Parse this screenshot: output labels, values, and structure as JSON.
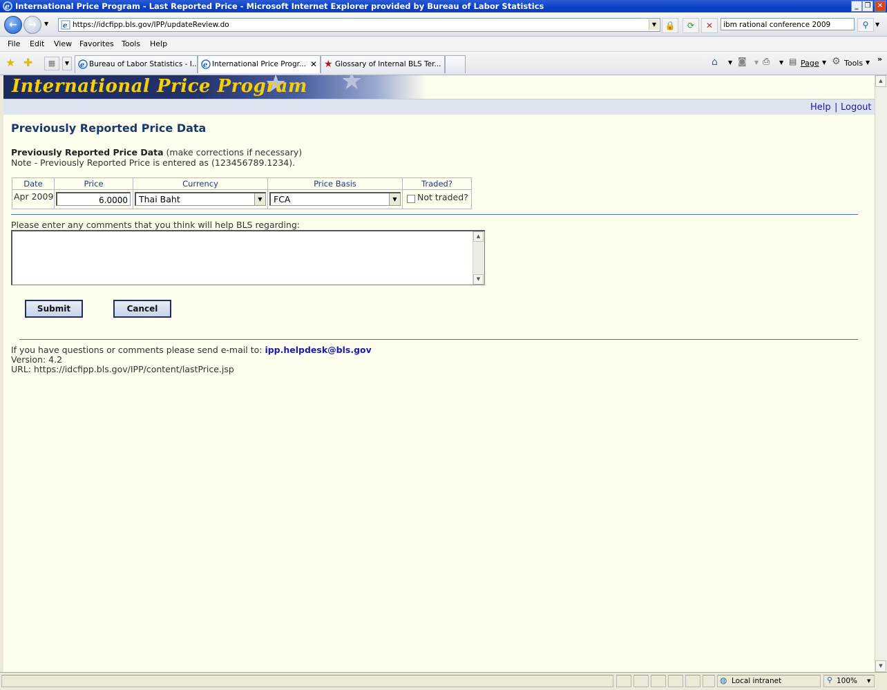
{
  "window": {
    "title": "International Price Program - Last Reported Price - Microsoft Internet Explorer provided by Bureau of Labor Statistics",
    "minimize_label": "_",
    "restore_label": "❐",
    "close_label": "✕"
  },
  "address_bar": {
    "url": "https://idcfipp.bls.gov/IPP/updateReview.do",
    "search_value": "ibm rational conference 2009"
  },
  "menu": {
    "items": [
      "File",
      "Edit",
      "View",
      "Favorites",
      "Tools",
      "Help"
    ]
  },
  "tabs": [
    {
      "label": "Bureau of Labor Statistics - I..."
    },
    {
      "label": "International Price Progr...",
      "close": "✕"
    },
    {
      "label": "Glossary of Internal BLS Ter..."
    }
  ],
  "command_bar": {
    "page_label": "Page",
    "tools_label": "Tools"
  },
  "banner": {
    "title": "International Price Program"
  },
  "links": {
    "help": "Help",
    "separator": "|",
    "logout": "Logout"
  },
  "page": {
    "heading": "Previously Reported Price Data",
    "intro_bold": "Previously Reported Price Data",
    "intro_rest": " (make corrections if necessary)",
    "note": "Note - Previously Reported Price is entered as (123456789.1234)."
  },
  "price_table": {
    "headers": [
      "Date",
      "Price",
      "Currency",
      "Price Basis",
      "Traded?"
    ],
    "date": "Apr 2009",
    "price": "6.0000",
    "currency": "Thai Baht",
    "price_basis": "FCA",
    "not_traded_label": "Not traded?",
    "not_traded_checked": false
  },
  "comments": {
    "label": "Please enter any comments that you think will help BLS regarding:",
    "value": ""
  },
  "buttons": {
    "submit": "Submit",
    "cancel": "Cancel"
  },
  "footer": {
    "contact_text": "If you have questions or comments please send e-mail to: ",
    "email": "ipp.helpdesk@bls.gov",
    "version": "Version: 4.2",
    "url": "URL: https://idcfipp.bls.gov/IPP/content/lastPrice.jsp"
  },
  "status_bar": {
    "zone": "Local intranet",
    "zoom": "100%"
  },
  "colors": {
    "banner_title": "#f5d100",
    "heading": "#18386e",
    "link": "#1a1a9a",
    "content_bg": "#fefeee"
  }
}
